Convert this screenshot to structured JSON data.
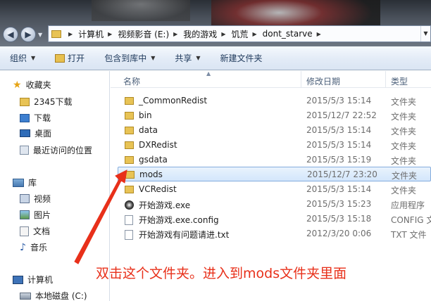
{
  "address": {
    "crumbs": [
      "计算机",
      "视频影音 (E:)",
      "我的游戏",
      "饥荒",
      "dont_starve"
    ]
  },
  "toolbar": {
    "organize": "组织",
    "open": "打开",
    "include": "包含到库中",
    "share": "共享",
    "new_folder": "新建文件夹"
  },
  "nav": {
    "favorites": "收藏夹",
    "fav_items": [
      "2345下载",
      "下载",
      "桌面",
      "最近访问的位置"
    ],
    "libraries": "库",
    "lib_items": [
      "视频",
      "图片",
      "文档",
      "音乐"
    ],
    "computer": "计算机",
    "computer_items": [
      "本地磁盘 (C:)"
    ]
  },
  "columns": {
    "name": "名称",
    "date": "修改日期",
    "type": "类型"
  },
  "files": [
    {
      "name": "_CommonRedist",
      "date": "2015/5/3 15:14",
      "type": "文件夹",
      "icon": "folder-icon"
    },
    {
      "name": "bin",
      "date": "2015/12/7 22:52",
      "type": "文件夹",
      "icon": "folder-icon"
    },
    {
      "name": "data",
      "date": "2015/5/3 15:14",
      "type": "文件夹",
      "icon": "folder-icon"
    },
    {
      "name": "DXRedist",
      "date": "2015/5/3 15:14",
      "type": "文件夹",
      "icon": "folder-icon"
    },
    {
      "name": "gsdata",
      "date": "2015/5/3 15:19",
      "type": "文件夹",
      "icon": "folder-icon"
    },
    {
      "name": "mods",
      "date": "2015/12/7 23:20",
      "type": "文件夹",
      "icon": "folder-icon",
      "selected": true
    },
    {
      "name": "VCRedist",
      "date": "2015/5/3 15:14",
      "type": "文件夹",
      "icon": "folder-icon"
    },
    {
      "name": "开始游戏.exe",
      "date": "2015/5/3 15:23",
      "type": "应用程序",
      "icon": "exe-icon"
    },
    {
      "name": "开始游戏.exe.config",
      "date": "2015/5/3 15:18",
      "type": "CONFIG 文",
      "icon": "config-file-icon"
    },
    {
      "name": "开始游戏有问题请进.txt",
      "date": "2012/3/20 0:06",
      "type": "TXT 文件",
      "icon": "text-file-icon"
    }
  ],
  "annotation": {
    "text": "双击这个文件夹。进入到mods文件夹里面",
    "color": "#e8301a"
  }
}
